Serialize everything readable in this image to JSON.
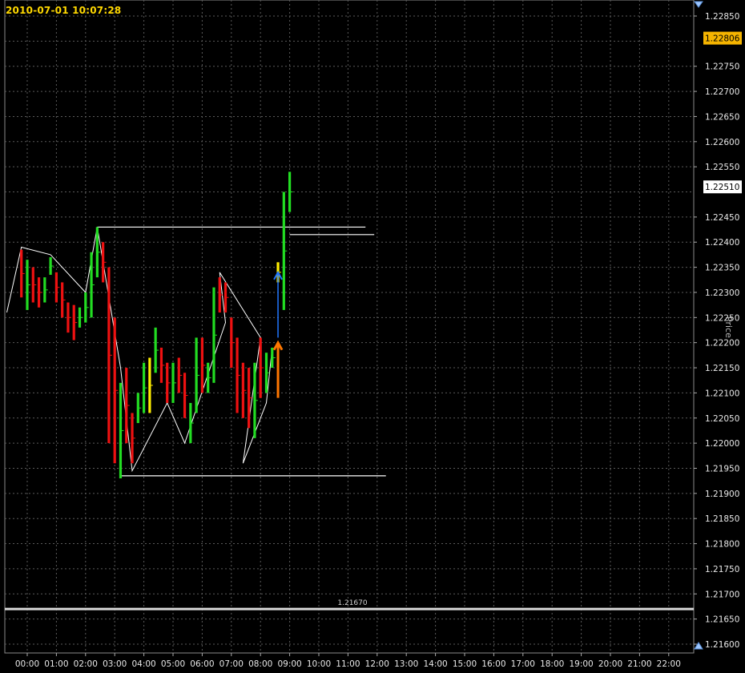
{
  "timestamp": "2010-07-01 10:07:28",
  "axis_title": "Price",
  "colors": {
    "background": "#000000",
    "grid": "#5a5a5a",
    "bull": "#22dd22",
    "bear": "#ee1111",
    "neutral": "#ffee00",
    "pattern": "#ffffff",
    "current_price_bg": "#f5b400",
    "label_bg": "#ffffff",
    "arrow_up": "#2277ff",
    "arrow_orange": "#ff7700"
  },
  "chart_data": {
    "type": "bar",
    "title": "",
    "ylim": [
      1.216,
      1.2285
    ],
    "y_ticks": [
      "1.22850",
      "1.22750",
      "1.22700",
      "1.22650",
      "1.22600",
      "1.22550",
      "1.22450",
      "1.22400",
      "1.22350",
      "1.22300",
      "1.22250",
      "1.22200",
      "1.22150",
      "1.22100",
      "1.22050",
      "1.22000",
      "1.21950",
      "1.21900",
      "1.21850",
      "1.21800",
      "1.21750",
      "1.21700",
      "1.21650",
      "1.21600"
    ],
    "x_labels": [
      "00:00",
      "01:00",
      "02:00",
      "03:00",
      "04:00",
      "05:00",
      "06:00",
      "07:00",
      "08:00",
      "09:00",
      "10:00",
      "11:00",
      "12:00",
      "13:00",
      "14:00",
      "15:00",
      "16:00",
      "17:00",
      "18:00",
      "19:00",
      "20:00",
      "21:00",
      "22:00"
    ],
    "current_price": "1.22806",
    "price_label": "1.22510",
    "support_label": "1.21670",
    "support_level": 1.2167,
    "grid": true,
    "bars": [
      {
        "t": -0.2,
        "h": 1.22385,
        "l": 1.2229,
        "c": "bear"
      },
      {
        "t": 0.0,
        "h": 1.22365,
        "l": 1.22265,
        "c": "green"
      },
      {
        "t": 0.2,
        "h": 1.2235,
        "l": 1.2228,
        "c": "bear"
      },
      {
        "t": 0.4,
        "h": 1.2233,
        "l": 1.2227,
        "c": "bear"
      },
      {
        "t": 0.6,
        "h": 1.2233,
        "l": 1.2228,
        "c": "green"
      },
      {
        "t": 0.8,
        "h": 1.2237,
        "l": 1.22335,
        "c": "green"
      },
      {
        "t": 1.0,
        "h": 1.2234,
        "l": 1.2228,
        "c": "bear"
      },
      {
        "t": 1.2,
        "h": 1.2232,
        "l": 1.2225,
        "c": "bear"
      },
      {
        "t": 1.4,
        "h": 1.2228,
        "l": 1.2222,
        "c": "bear"
      },
      {
        "t": 1.6,
        "h": 1.22275,
        "l": 1.22205,
        "c": "bear"
      },
      {
        "t": 1.8,
        "h": 1.2227,
        "l": 1.2223,
        "c": "green"
      },
      {
        "t": 2.0,
        "h": 1.223,
        "l": 1.2224,
        "c": "green"
      },
      {
        "t": 2.2,
        "h": 1.2238,
        "l": 1.2225,
        "c": "green"
      },
      {
        "t": 2.4,
        "h": 1.2243,
        "l": 1.2233,
        "c": "green"
      },
      {
        "t": 2.6,
        "h": 1.224,
        "l": 1.2232,
        "c": "bear"
      },
      {
        "t": 2.8,
        "h": 1.2235,
        "l": 1.22,
        "c": "bear"
      },
      {
        "t": 3.0,
        "h": 1.2225,
        "l": 1.2196,
        "c": "bear"
      },
      {
        "t": 3.2,
        "h": 1.2212,
        "l": 1.2193,
        "c": "green"
      },
      {
        "t": 3.4,
        "h": 1.2215,
        "l": 1.22,
        "c": "bear"
      },
      {
        "t": 3.6,
        "h": 1.2206,
        "l": 1.2196,
        "c": "bear"
      },
      {
        "t": 3.8,
        "h": 1.221,
        "l": 1.2204,
        "c": "green"
      },
      {
        "t": 4.0,
        "h": 1.2216,
        "l": 1.2206,
        "c": "green"
      },
      {
        "t": 4.2,
        "h": 1.2217,
        "l": 1.2206,
        "c": "neutral"
      },
      {
        "t": 4.4,
        "h": 1.2223,
        "l": 1.2214,
        "c": "green"
      },
      {
        "t": 4.6,
        "h": 1.2219,
        "l": 1.2212,
        "c": "bear"
      },
      {
        "t": 4.8,
        "h": 1.2216,
        "l": 1.2208,
        "c": "bear"
      },
      {
        "t": 5.0,
        "h": 1.2216,
        "l": 1.2208,
        "c": "green"
      },
      {
        "t": 5.2,
        "h": 1.2217,
        "l": 1.221,
        "c": "bear"
      },
      {
        "t": 5.4,
        "h": 1.2214,
        "l": 1.2205,
        "c": "bear"
      },
      {
        "t": 5.6,
        "h": 1.2208,
        "l": 1.22,
        "c": "green"
      },
      {
        "t": 5.8,
        "h": 1.2221,
        "l": 1.2206,
        "c": "green"
      },
      {
        "t": 6.0,
        "h": 1.2221,
        "l": 1.221,
        "c": "bear"
      },
      {
        "t": 6.2,
        "h": 1.2216,
        "l": 1.221,
        "c": "green"
      },
      {
        "t": 6.4,
        "h": 1.2231,
        "l": 1.2212,
        "c": "green"
      },
      {
        "t": 6.6,
        "h": 1.2233,
        "l": 1.2226,
        "c": "bear"
      },
      {
        "t": 6.8,
        "h": 1.2232,
        "l": 1.2226,
        "c": "bear"
      },
      {
        "t": 7.0,
        "h": 1.2225,
        "l": 1.2215,
        "c": "bear"
      },
      {
        "t": 7.2,
        "h": 1.2221,
        "l": 1.2206,
        "c": "bear"
      },
      {
        "t": 7.4,
        "h": 1.2216,
        "l": 1.2205,
        "c": "bear"
      },
      {
        "t": 7.6,
        "h": 1.2215,
        "l": 1.2203,
        "c": "bear"
      },
      {
        "t": 7.8,
        "h": 1.2216,
        "l": 1.2201,
        "c": "green"
      },
      {
        "t": 8.0,
        "h": 1.2221,
        "l": 1.2209,
        "c": "bear"
      },
      {
        "t": 8.2,
        "h": 1.2218,
        "l": 1.221,
        "c": "green"
      },
      {
        "t": 8.4,
        "h": 1.2219,
        "l": 1.2215,
        "c": "green"
      },
      {
        "t": 8.6,
        "h": 1.2236,
        "l": 1.2232,
        "c": "neutral"
      },
      {
        "t": 8.8,
        "h": 1.225,
        "l": 1.22265,
        "c": "green"
      },
      {
        "t": 9.0,
        "h": 1.2254,
        "l": 1.2246,
        "c": "green"
      }
    ],
    "pattern_lines": [
      [
        [
          -0.7,
          1.2226
        ],
        [
          -0.2,
          1.2239
        ],
        [
          0.8,
          1.22375
        ],
        [
          2.0,
          1.223
        ],
        [
          2.4,
          1.2243
        ],
        [
          3.2,
          1.2215
        ],
        [
          3.6,
          1.21945
        ],
        [
          4.8,
          1.2208
        ],
        [
          5.4,
          1.22
        ],
        [
          6.8,
          1.2224
        ],
        [
          6.6,
          1.2234
        ],
        [
          8.0,
          1.2221
        ],
        [
          7.4,
          1.2196
        ],
        [
          8.2,
          1.2208
        ],
        [
          8.4,
          1.2219
        ]
      ]
    ],
    "horizontal_segments": [
      {
        "from": 2.4,
        "to": 11.6,
        "y": 1.2243
      },
      {
        "from": 9.0,
        "to": 11.9,
        "y": 1.22415
      },
      {
        "from": 3.2,
        "to": 12.3,
        "y": 1.21935
      }
    ],
    "arrows": [
      {
        "x": 8.6,
        "y_from": 1.2221,
        "y_to": 1.2234,
        "color": "arrow_up"
      },
      {
        "x": 8.6,
        "y_from": 1.2209,
        "y_to": 1.222,
        "color": "arrow_orange"
      }
    ]
  }
}
